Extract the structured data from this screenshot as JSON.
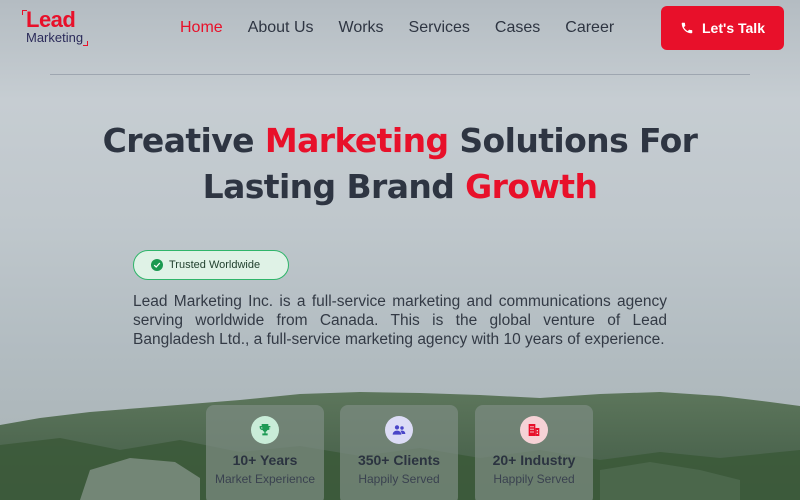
{
  "brand": {
    "logo_line1": "Lead",
    "logo_line2": "Marketing"
  },
  "nav": {
    "items": [
      {
        "label": "Home",
        "active": true
      },
      {
        "label": "About Us",
        "active": false
      },
      {
        "label": "Works",
        "active": false
      },
      {
        "label": "Services",
        "active": false
      },
      {
        "label": "Cases",
        "active": false
      },
      {
        "label": "Career",
        "active": false
      }
    ],
    "cta_label": "Let's Talk",
    "cta_icon": "phone-icon"
  },
  "hero": {
    "line1_part1": "Creative ",
    "line1_highlight": "Marketing",
    "line1_part2": " Solutions For",
    "line2_part1": "Lasting Brand ",
    "line2_highlight": "Growth",
    "badge_label": "Trusted Worldwide",
    "badge_icon": "check-circle-icon",
    "description": "Lead Marketing Inc. is a full-service marketing and communications agency serving worldwide from Canada. This is the global venture of Lead Bangladesh Ltd., a full-service marketing agency with 10 years of experience."
  },
  "stats": [
    {
      "value": "10+ Years",
      "label": "Market Experience",
      "icon": "trophy-icon"
    },
    {
      "value": "350+ Clients",
      "label": "Happily Served",
      "icon": "users-icon"
    },
    {
      "value": "20+ Industry",
      "label": "Happily Served",
      "icon": "building-icon"
    }
  ],
  "colors": {
    "accent": "#e8102a",
    "text_dark": "#2e3542",
    "badge_green": "#2fb56a",
    "stat_trophy_bg": "#c9ecd8",
    "stat_users_bg": "#dcdcf6",
    "stat_building_bg": "#f6d2d6"
  }
}
